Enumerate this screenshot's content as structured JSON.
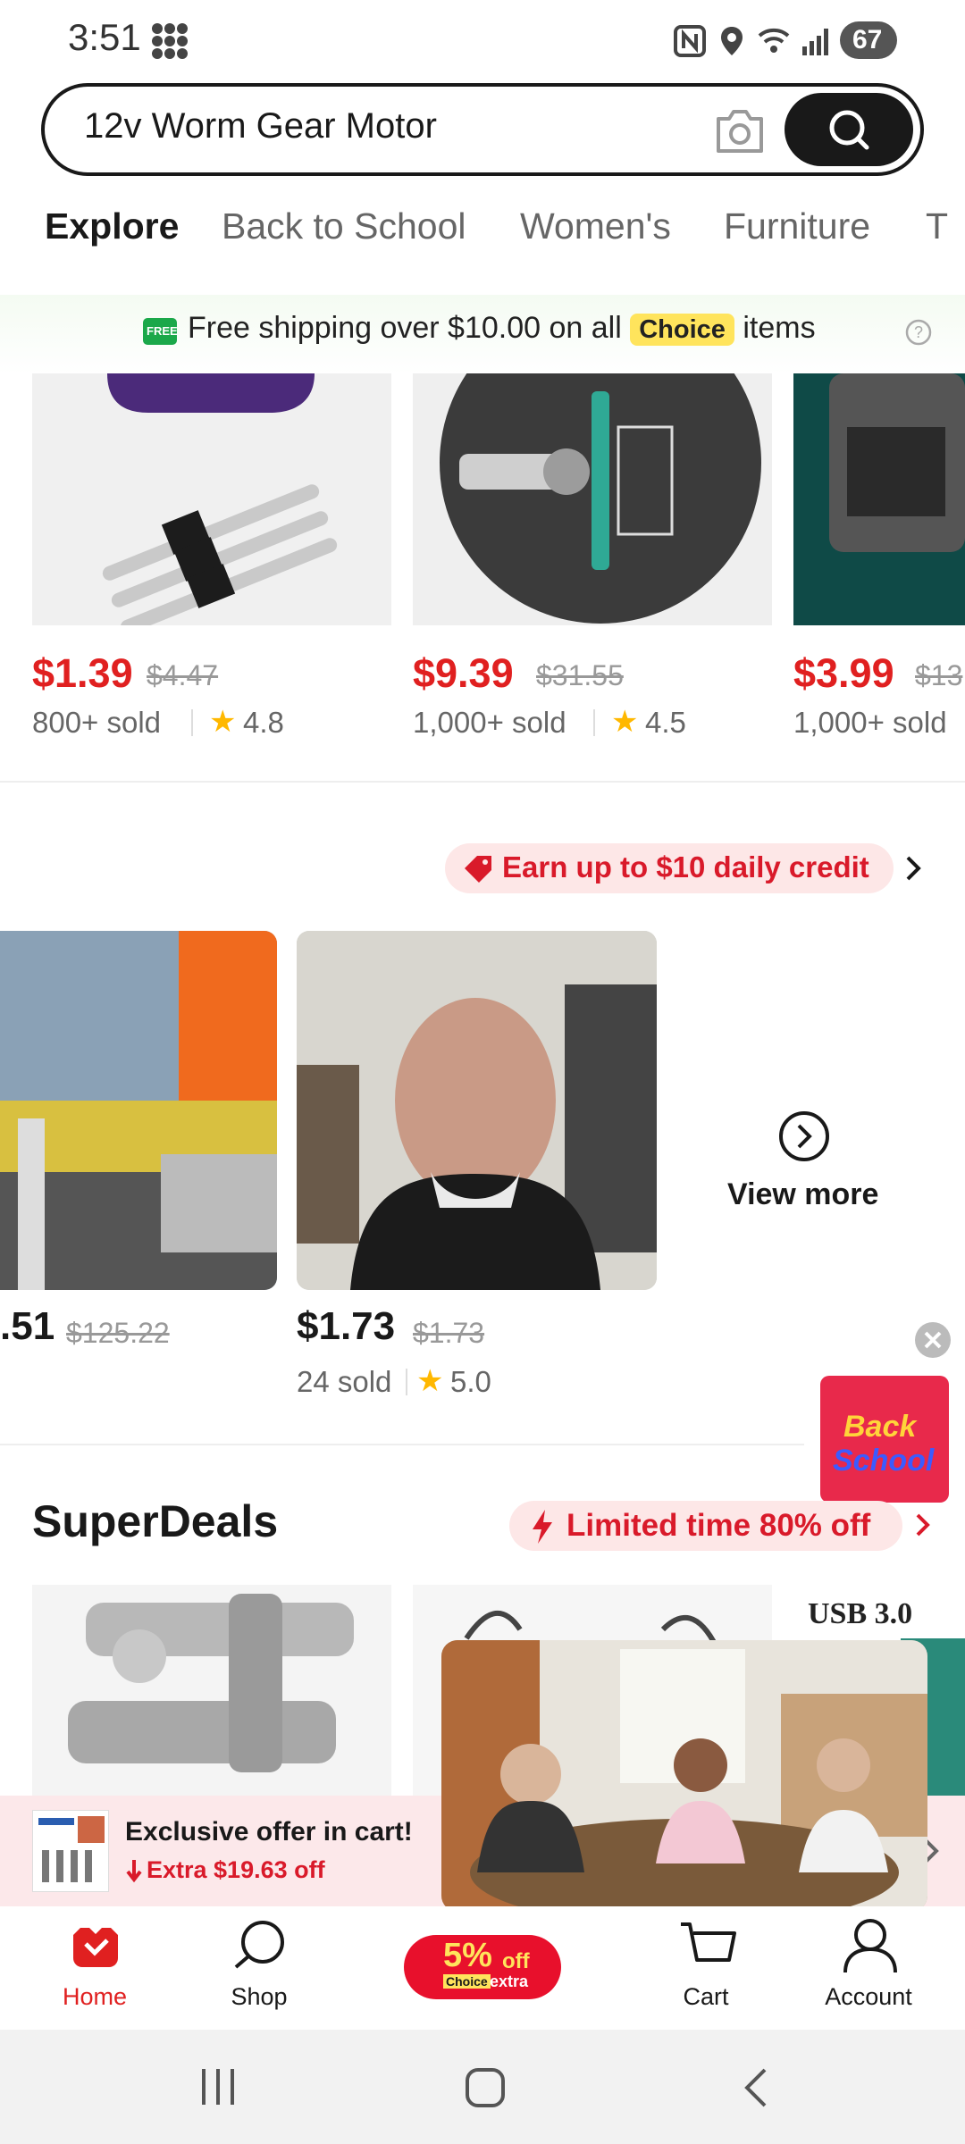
{
  "status": {
    "time": "3:51",
    "battery": "67"
  },
  "search": {
    "value": "12v Worm Gear Motor"
  },
  "tabs": [
    "Explore",
    "Back to School",
    "Women's",
    "Furniture",
    "T"
  ],
  "shipping": {
    "text_before": "Free shipping over $10.00 on all",
    "badge": "Choice",
    "text_after": "items",
    "free_icon_label": "FREE"
  },
  "products_row1": [
    {
      "price": "$1.39",
      "old_price": "$4.47",
      "sold": "800+ sold",
      "rating": "4.8"
    },
    {
      "price": "$9.39",
      "old_price": "$31.55",
      "sold": "1,000+ sold",
      "rating": "4.5"
    },
    {
      "price": "$3.99",
      "old_price": "$13",
      "sold": "1,000+ sold"
    }
  ],
  "earn": {
    "label": "Earn up to $10 daily credit"
  },
  "videos": [
    {
      "price": ".51",
      "old_price": "$125.22"
    },
    {
      "price": "$1.73",
      "old_price": "$1.73",
      "sold": "24 sold",
      "rating": "5.0"
    }
  ],
  "view_more": {
    "label": "View more"
  },
  "back_to_school_badge": {
    "line1": "Back",
    "line2": "School"
  },
  "superdeals": {
    "title": "SuperDeals",
    "limited": "Limited time 80% off",
    "usb_label": "USB 3.0"
  },
  "cart_offer": {
    "title": "Exclusive offer in cart!",
    "subtitle": "Extra $19.63 off"
  },
  "bottom_nav": {
    "home": "Home",
    "shop": "Shop",
    "promo_pct": "5%",
    "promo_off": "off",
    "promo_choice": "Choice",
    "promo_extra": "extra",
    "cart": "Cart",
    "account": "Account"
  },
  "colors": {
    "accent": "#e02020",
    "choice_yellow": "#ffe45c",
    "dark": "#191919"
  }
}
